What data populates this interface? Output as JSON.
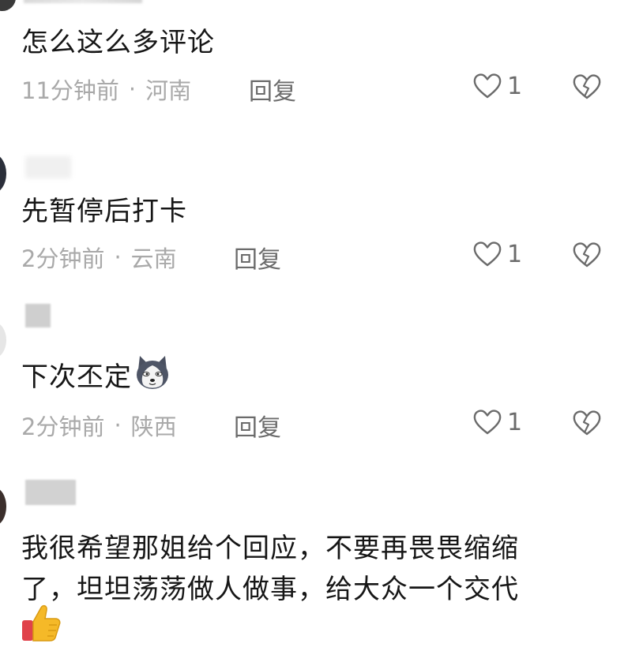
{
  "comments": [
    {
      "text": "怎么这么多评论",
      "time": "11分钟前",
      "separator": "·",
      "location": "河南",
      "reply_label": "回复",
      "likes": "1"
    },
    {
      "text": "先暂停后打卡",
      "time": "2分钟前",
      "separator": "·",
      "location": "云南",
      "reply_label": "回复",
      "likes": "1"
    },
    {
      "text": "下次丕定",
      "emoji": "husky-dog-emoji",
      "time": "2分钟前",
      "separator": "·",
      "location": "陕西",
      "reply_label": "回复",
      "likes": "1"
    },
    {
      "text_line1": "我很希望那姐给个回应，不要再畏畏缩缩",
      "text_line2": "了，坦坦荡荡做人做事，给大众一个交代",
      "emoji": "thumbs-up-emoji"
    }
  ],
  "icons": {
    "like": "heart-icon",
    "dislike": "broken-heart-icon"
  },
  "colors": {
    "text": "#161616",
    "meta": "#a9a9a9",
    "action": "#6b6b6b"
  }
}
